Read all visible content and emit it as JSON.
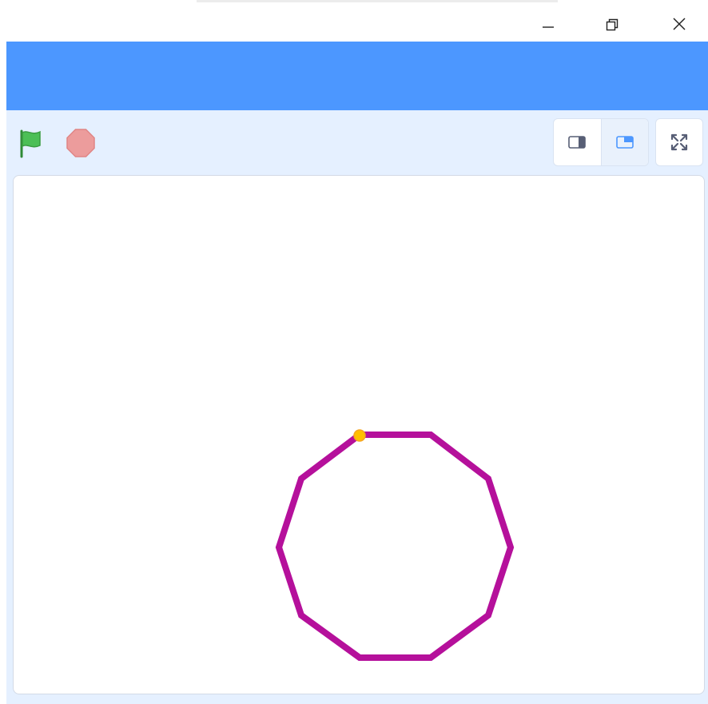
{
  "window": {
    "controls": [
      "minimize-icon",
      "restore-icon",
      "close-icon"
    ]
  },
  "colors": {
    "menubar": "#4c97ff",
    "stage_header_bg": "#e5f0ff",
    "flag_green": "#4cbf56",
    "stop_red": "#ec9c9c",
    "selected_layout": "#4c97ff",
    "pen_color": "#b5109b",
    "sprite_dot": "#ffbf00"
  },
  "stage_header": {
    "flag": "green-flag-icon",
    "stop": "stop-icon",
    "layout_buttons": [
      "small-stage-icon",
      "normal-stage-icon"
    ],
    "selected_layout": "normal-stage-icon",
    "fullscreen": "fullscreen-icon"
  },
  "stage": {
    "drawing": {
      "shape": "decagon",
      "sides": 10,
      "pen_color": "#b5109b"
    },
    "sprite": "pen-sprite-dot"
  }
}
